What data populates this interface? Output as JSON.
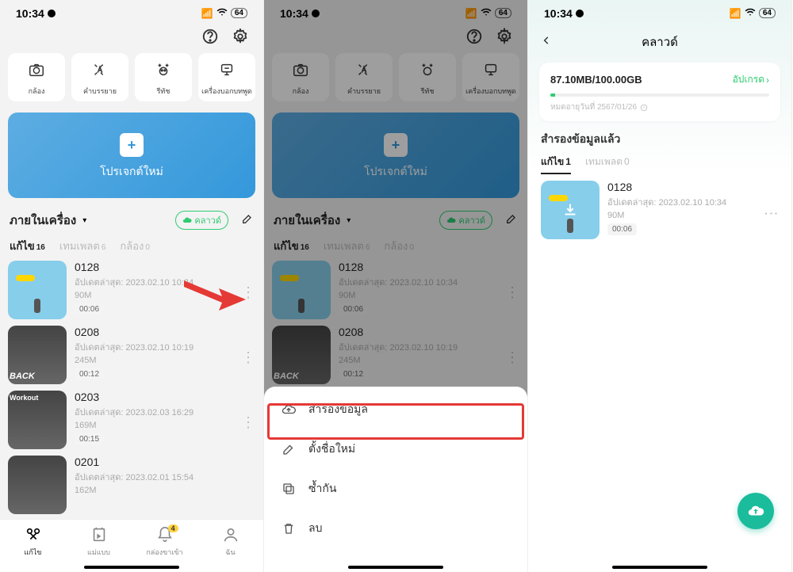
{
  "status": {
    "time": "10:34",
    "battery": "64"
  },
  "shortcuts": [
    {
      "label": "กล้อง"
    },
    {
      "label": "คําบรรยาย"
    },
    {
      "label": "รีทัช"
    },
    {
      "label": "เครื่องบอกบทพูด"
    }
  ],
  "newproject": "โปรเจกต์ใหม่",
  "section": "ภายในเครื่อง",
  "cloud_badge": "คลาวด์",
  "tabs": [
    {
      "label": "แก้ไข",
      "count": "16"
    },
    {
      "label": "เทมเพลต",
      "count": "6"
    },
    {
      "label": "กล้อง",
      "count": "0"
    }
  ],
  "projects": [
    {
      "name": "0128",
      "updated": "อัปเดตล่าสุด: 2023.02.10 10:34",
      "size": "90M",
      "dur": "00:06"
    },
    {
      "name": "0208",
      "updated": "อัปเดตล่าสุด: 2023.02.10 10:19",
      "size": "245M",
      "dur": "00:12"
    },
    {
      "name": "0203",
      "updated": "อัปเดตล่าสุด: 2023.02.03 16:29",
      "size": "169M",
      "dur": "00:15"
    },
    {
      "name": "0201",
      "updated": "อัปเดตล่าสุด: 2023.02.01 15:54",
      "size": "162M",
      "dur": ""
    }
  ],
  "bottomnav": [
    {
      "label": "แก้ไข"
    },
    {
      "label": "แม่แบบ"
    },
    {
      "label": "กล่องขาเข้า"
    },
    {
      "label": "ฉัน"
    }
  ],
  "sheet": [
    {
      "label": "สำรองข้อมูล"
    },
    {
      "label": "ตั้งชื่อใหม่"
    },
    {
      "label": "ซ้ำกัน"
    },
    {
      "label": "ลบ"
    }
  ],
  "s3": {
    "title": "คลาวด์",
    "usage": "87.10MB/100.00GB",
    "upgrade": "อัปเกรด",
    "expire": "หมดอายุวันที่ 2567/01/26",
    "backed": "สำรองข้อมูลแล้ว",
    "tabs": [
      {
        "label": "แก้ไข",
        "count": "1"
      },
      {
        "label": "เทมเพลต",
        "count": "0"
      }
    ],
    "proj": {
      "name": "0128",
      "updated": "อัปเดตล่าสุด: 2023.02.10 10:34",
      "size": "90M",
      "dur": "00:06"
    }
  }
}
